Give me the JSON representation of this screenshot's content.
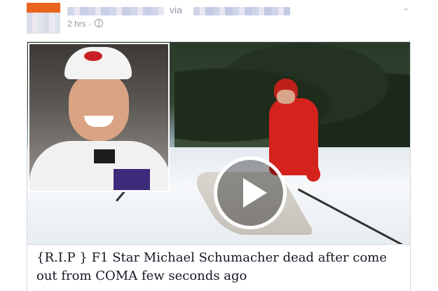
{
  "post": {
    "via_label": "via",
    "timestamp": "2 hrs",
    "timestamp_separator": "·",
    "chevron": "⌄"
  },
  "media": {
    "play_icon": "play-icon"
  },
  "caption": {
    "text": "{R.I.P } F1 Star Michael Schumacher dead after come out from COMA few seconds ago"
  }
}
